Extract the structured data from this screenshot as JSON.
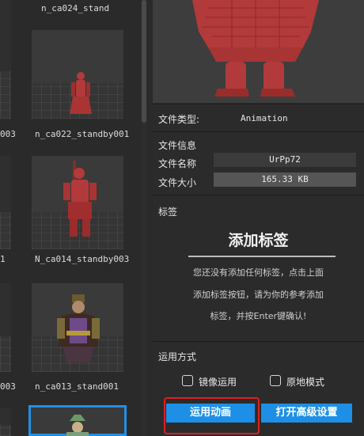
{
  "grid": {
    "left_captions": [
      "003",
      "003",
      "1",
      "003",
      "001"
    ],
    "items": [
      {
        "caption": "n_ca024_stand"
      },
      {
        "caption": "n_ca022_standby001"
      },
      {
        "caption": "N_ca014_standby003"
      },
      {
        "caption": "n_ca013_stand001"
      },
      {
        "caption": ""
      }
    ]
  },
  "info": {
    "file_type_label": "文件类型:",
    "file_type_value": "Animation",
    "file_info_title": "文件信息",
    "file_name_label": "文件名称",
    "file_name_value": "UrPp72",
    "file_size_label": "文件大小",
    "file_size_value": "165.33 KB"
  },
  "tags": {
    "section_title": "标签",
    "add_tag": "添加标签",
    "hint_lines": [
      "您还没有添加任何标签，点击上面",
      "添加标签按钮，请为你的参考添加",
      "标签，并按Enter键确认!"
    ]
  },
  "apply": {
    "section_title": "运用方式",
    "mirror_label": "镜像运用",
    "mirror_checked": false,
    "inplace_label": "原地模式",
    "inplace_checked": false,
    "apply_button": "运用动画",
    "advanced_button": "打开高级设置"
  },
  "colors": {
    "accent": "#1e8fe6",
    "highlight": "#e02020",
    "character": "#b23a3a"
  }
}
